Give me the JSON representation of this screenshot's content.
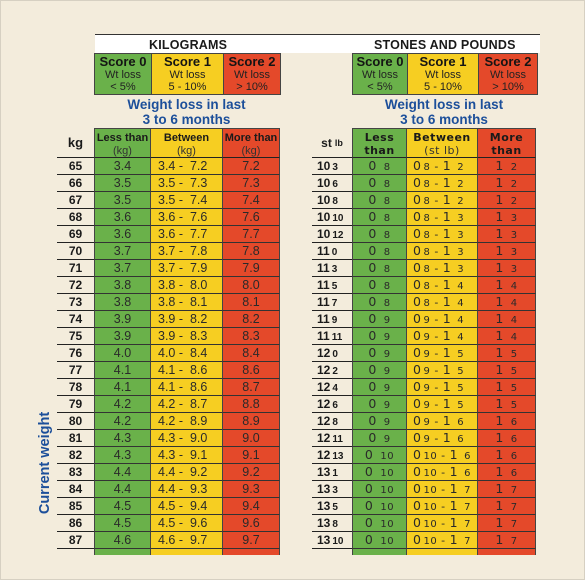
{
  "kilograms": {
    "title": "KILOGRAMS",
    "scores": [
      {
        "label": "Score 0",
        "line1": "Wt loss",
        "line2": "< 5%",
        "color": "#6ab14a"
      },
      {
        "label": "Score 1",
        "line1": "Wt loss",
        "line2": "5 - 10%",
        "color": "#f6ce22"
      },
      {
        "label": "Score 2",
        "line1": "Wt loss",
        "line2": "> 10%",
        "color": "#e4492a"
      }
    ],
    "subtitle_line1": "Weight loss in last",
    "subtitle_line2": "3 to 6 months",
    "row_header": "kg",
    "columns": [
      {
        "label": "Less than",
        "unit": "(kg)"
      },
      {
        "label": "Between",
        "unit": "(kg)"
      },
      {
        "label": "More than",
        "unit": "(kg)"
      }
    ],
    "rows": [
      {
        "weight": "65",
        "less": "3.4",
        "between": "3.4 -  7.2",
        "more": "7.2"
      },
      {
        "weight": "66",
        "less": "3.5",
        "between": "3.5 -  7.3",
        "more": "7.3"
      },
      {
        "weight": "67",
        "less": "3.5",
        "between": "3.5 -  7.4",
        "more": "7.4"
      },
      {
        "weight": "68",
        "less": "3.6",
        "between": "3.6 -  7.6",
        "more": "7.6"
      },
      {
        "weight": "69",
        "less": "3.6",
        "between": "3.6 -  7.7",
        "more": "7.7"
      },
      {
        "weight": "70",
        "less": "3.7",
        "between": "3.7 -  7.8",
        "more": "7.8"
      },
      {
        "weight": "71",
        "less": "3.7",
        "between": "3.7 -  7.9",
        "more": "7.9"
      },
      {
        "weight": "72",
        "less": "3.8",
        "between": "3.8 -  8.0",
        "more": "8.0"
      },
      {
        "weight": "73",
        "less": "3.8",
        "between": "3.8 -  8.1",
        "more": "8.1"
      },
      {
        "weight": "74",
        "less": "3.9",
        "between": "3.9 -  8.2",
        "more": "8.2"
      },
      {
        "weight": "75",
        "less": "3.9",
        "between": "3.9 -  8.3",
        "more": "8.3"
      },
      {
        "weight": "76",
        "less": "4.0",
        "between": "4.0 -  8.4",
        "more": "8.4"
      },
      {
        "weight": "77",
        "less": "4.1",
        "between": "4.1 -  8.6",
        "more": "8.6"
      },
      {
        "weight": "78",
        "less": "4.1",
        "between": "4.1 -  8.6",
        "more": "8.7"
      },
      {
        "weight": "79",
        "less": "4.2",
        "between": "4.2 -  8.7",
        "more": "8.8"
      },
      {
        "weight": "80",
        "less": "4.2",
        "between": "4.2 -  8.9",
        "more": "8.9"
      },
      {
        "weight": "81",
        "less": "4.3",
        "between": "4.3 -  9.0",
        "more": "9.0"
      },
      {
        "weight": "82",
        "less": "4.3",
        "between": "4.3 -  9.1",
        "more": "9.1"
      },
      {
        "weight": "83",
        "less": "4.4",
        "between": "4.4 -  9.2",
        "more": "9.2"
      },
      {
        "weight": "84",
        "less": "4.4",
        "between": "4.4 -  9.3",
        "more": "9.3"
      },
      {
        "weight": "85",
        "less": "4.5",
        "between": "4.5 -  9.4",
        "more": "9.4"
      },
      {
        "weight": "86",
        "less": "4.5",
        "between": "4.5 -  9.6",
        "more": "9.6"
      },
      {
        "weight": "87",
        "less": "4.6",
        "between": "4.6 -  9.7",
        "more": "9.7"
      }
    ]
  },
  "stones": {
    "title": "STONES AND POUNDS",
    "scores": [
      {
        "label": "Score 0",
        "line1": "Wt loss",
        "line2": "< 5%",
        "color": "#6ab14a"
      },
      {
        "label": "Score 1",
        "line1": "Wt loss",
        "line2": "5 - 10%",
        "color": "#f6ce22"
      },
      {
        "label": "Score 2",
        "line1": "Wt loss",
        "line2": "> 10%",
        "color": "#e4492a"
      }
    ],
    "subtitle_line1": "Weight loss in last",
    "subtitle_line2": "3 to 6 months",
    "row_header_st": "st",
    "row_header_lb": "lb",
    "columns": [
      {
        "label": "Less than",
        "unit": "(st lb)"
      },
      {
        "label": "Between",
        "unit": "(st lb)"
      },
      {
        "label": "More than",
        "unit": "(st lb)"
      }
    ],
    "rows": [
      {
        "st": "10",
        "lb": "3",
        "less_st": "0",
        "less_lb": "8",
        "bw_st1": "0",
        "bw_lb1": "8",
        "bw_st2": "1",
        "bw_lb2": "2",
        "more_st": "1",
        "more_lb": "2"
      },
      {
        "st": "10",
        "lb": "6",
        "less_st": "0",
        "less_lb": "8",
        "bw_st1": "0",
        "bw_lb1": "8",
        "bw_st2": "1",
        "bw_lb2": "2",
        "more_st": "1",
        "more_lb": "2"
      },
      {
        "st": "10",
        "lb": "8",
        "less_st": "0",
        "less_lb": "8",
        "bw_st1": "0",
        "bw_lb1": "8",
        "bw_st2": "1",
        "bw_lb2": "2",
        "more_st": "1",
        "more_lb": "2"
      },
      {
        "st": "10",
        "lb": "10",
        "less_st": "0",
        "less_lb": "8",
        "bw_st1": "0",
        "bw_lb1": "8",
        "bw_st2": "1",
        "bw_lb2": "3",
        "more_st": "1",
        "more_lb": "3"
      },
      {
        "st": "10",
        "lb": "12",
        "less_st": "0",
        "less_lb": "8",
        "bw_st1": "0",
        "bw_lb1": "8",
        "bw_st2": "1",
        "bw_lb2": "3",
        "more_st": "1",
        "more_lb": "3"
      },
      {
        "st": "11",
        "lb": "0",
        "less_st": "0",
        "less_lb": "8",
        "bw_st1": "0",
        "bw_lb1": "8",
        "bw_st2": "1",
        "bw_lb2": "3",
        "more_st": "1",
        "more_lb": "3"
      },
      {
        "st": "11",
        "lb": "3",
        "less_st": "0",
        "less_lb": "8",
        "bw_st1": "0",
        "bw_lb1": "8",
        "bw_st2": "1",
        "bw_lb2": "3",
        "more_st": "1",
        "more_lb": "3"
      },
      {
        "st": "11",
        "lb": "5",
        "less_st": "0",
        "less_lb": "8",
        "bw_st1": "0",
        "bw_lb1": "8",
        "bw_st2": "1",
        "bw_lb2": "4",
        "more_st": "1",
        "more_lb": "4"
      },
      {
        "st": "11",
        "lb": "7",
        "less_st": "0",
        "less_lb": "8",
        "bw_st1": "0",
        "bw_lb1": "8",
        "bw_st2": "1",
        "bw_lb2": "4",
        "more_st": "1",
        "more_lb": "4"
      },
      {
        "st": "11",
        "lb": "9",
        "less_st": "0",
        "less_lb": "9",
        "bw_st1": "0",
        "bw_lb1": "9",
        "bw_st2": "1",
        "bw_lb2": "4",
        "more_st": "1",
        "more_lb": "4"
      },
      {
        "st": "11",
        "lb": "11",
        "less_st": "0",
        "less_lb": "9",
        "bw_st1": "0",
        "bw_lb1": "9",
        "bw_st2": "1",
        "bw_lb2": "4",
        "more_st": "1",
        "more_lb": "4"
      },
      {
        "st": "12",
        "lb": "0",
        "less_st": "0",
        "less_lb": "9",
        "bw_st1": "0",
        "bw_lb1": "9",
        "bw_st2": "1",
        "bw_lb2": "5",
        "more_st": "1",
        "more_lb": "5"
      },
      {
        "st": "12",
        "lb": "2",
        "less_st": "0",
        "less_lb": "9",
        "bw_st1": "0",
        "bw_lb1": "9",
        "bw_st2": "1",
        "bw_lb2": "5",
        "more_st": "1",
        "more_lb": "5"
      },
      {
        "st": "12",
        "lb": "4",
        "less_st": "0",
        "less_lb": "9",
        "bw_st1": "0",
        "bw_lb1": "9",
        "bw_st2": "1",
        "bw_lb2": "5",
        "more_st": "1",
        "more_lb": "5"
      },
      {
        "st": "12",
        "lb": "6",
        "less_st": "0",
        "less_lb": "9",
        "bw_st1": "0",
        "bw_lb1": "9",
        "bw_st2": "1",
        "bw_lb2": "5",
        "more_st": "1",
        "more_lb": "5"
      },
      {
        "st": "12",
        "lb": "8",
        "less_st": "0",
        "less_lb": "9",
        "bw_st1": "0",
        "bw_lb1": "9",
        "bw_st2": "1",
        "bw_lb2": "6",
        "more_st": "1",
        "more_lb": "6"
      },
      {
        "st": "12",
        "lb": "11",
        "less_st": "0",
        "less_lb": "9",
        "bw_st1": "0",
        "bw_lb1": "9",
        "bw_st2": "1",
        "bw_lb2": "6",
        "more_st": "1",
        "more_lb": "6"
      },
      {
        "st": "12",
        "lb": "13",
        "less_st": "0",
        "less_lb": "10",
        "bw_st1": "0",
        "bw_lb1": "10",
        "bw_st2": "1",
        "bw_lb2": "6",
        "more_st": "1",
        "more_lb": "6"
      },
      {
        "st": "13",
        "lb": "1",
        "less_st": "0",
        "less_lb": "10",
        "bw_st1": "0",
        "bw_lb1": "10",
        "bw_st2": "1",
        "bw_lb2": "6",
        "more_st": "1",
        "more_lb": "6"
      },
      {
        "st": "13",
        "lb": "3",
        "less_st": "0",
        "less_lb": "10",
        "bw_st1": "0",
        "bw_lb1": "10",
        "bw_st2": "1",
        "bw_lb2": "7",
        "more_st": "1",
        "more_lb": "7"
      },
      {
        "st": "13",
        "lb": "5",
        "less_st": "0",
        "less_lb": "10",
        "bw_st1": "0",
        "bw_lb1": "10",
        "bw_st2": "1",
        "bw_lb2": "7",
        "more_st": "1",
        "more_lb": "7"
      },
      {
        "st": "13",
        "lb": "8",
        "less_st": "0",
        "less_lb": "10",
        "bw_st1": "0",
        "bw_lb1": "10",
        "bw_st2": "1",
        "bw_lb2": "7",
        "more_st": "1",
        "more_lb": "7"
      },
      {
        "st": "13",
        "lb": "10",
        "less_st": "0",
        "less_lb": "10",
        "bw_st1": "0",
        "bw_lb1": "10",
        "bw_st2": "1",
        "bw_lb2": "7",
        "more_st": "1",
        "more_lb": "7"
      }
    ]
  },
  "side_label": "Current weight",
  "colors": {
    "green": "#6ab14a",
    "yellow": "#f6ce22",
    "red": "#e4492a",
    "blue_text": "#1c4f9a",
    "background": "#f3ecdc"
  }
}
